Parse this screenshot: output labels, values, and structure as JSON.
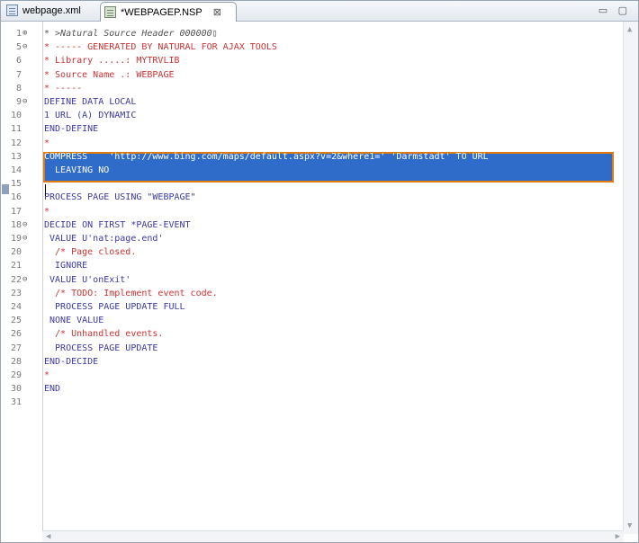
{
  "tabs": [
    {
      "label": "webpage.xml"
    },
    {
      "label": "*WEBPAGEP.NSP",
      "close": "⊠"
    }
  ],
  "window_controls": "▭ ▢",
  "lines": [
    {
      "num": "1",
      "fold": "⊕",
      "text": "* >Natural Source Header 000000▯",
      "style": "gray"
    },
    {
      "num": "5",
      "fold": "⊖",
      "text": "* ----- GENERATED BY NATURAL FOR AJAX TOOLS",
      "style": "red"
    },
    {
      "num": "6",
      "fold": "",
      "text": "* Library .....: MYTRVLIB",
      "style": "red"
    },
    {
      "num": "7",
      "fold": "",
      "text": "* Source Name .: WEBPAGE",
      "style": "red"
    },
    {
      "num": "8",
      "fold": "",
      "text": "* -----",
      "style": "red"
    },
    {
      "num": "9",
      "fold": "⊖",
      "text": "DEFINE DATA LOCAL",
      "style": "blue"
    },
    {
      "num": "10",
      "fold": "",
      "text": "1 URL (A) DYNAMIC",
      "style": "blue"
    },
    {
      "num": "11",
      "fold": "",
      "text": "END-DEFINE",
      "style": "blue"
    },
    {
      "num": "12",
      "fold": "",
      "text": "*",
      "style": "red"
    },
    {
      "num": "13",
      "fold": "",
      "text": "COMPRESS    'http://www.bing.com/maps/default.aspx?v=2&where1=' 'Darmstadt' TO URL",
      "style": "hl"
    },
    {
      "num": "14",
      "fold": "",
      "text": "  LEAVING NO",
      "style": "hl"
    },
    {
      "num": "15",
      "fold": "",
      "text": "",
      "style": "blue"
    },
    {
      "num": "16",
      "fold": "",
      "text": "PROCESS PAGE USING \"WEBPAGE\"",
      "style": "blue"
    },
    {
      "num": "17",
      "fold": "",
      "text": "*",
      "style": "red"
    },
    {
      "num": "18",
      "fold": "⊖",
      "text": "DECIDE ON FIRST *PAGE-EVENT",
      "style": "blue"
    },
    {
      "num": "19",
      "fold": "⊖",
      "text": " VALUE U'nat:page.end'",
      "style": "blue"
    },
    {
      "num": "20",
      "fold": "",
      "text": "  /* Page closed.",
      "style": "red"
    },
    {
      "num": "21",
      "fold": "",
      "text": "  IGNORE",
      "style": "blue"
    },
    {
      "num": "22",
      "fold": "⊖",
      "text": " VALUE U'onExit'",
      "style": "blue"
    },
    {
      "num": "23",
      "fold": "",
      "text": "  /* TODO: Implement event code.",
      "style": "red"
    },
    {
      "num": "24",
      "fold": "",
      "text": "  PROCESS PAGE UPDATE FULL",
      "style": "blue"
    },
    {
      "num": "25",
      "fold": "",
      "text": " NONE VALUE",
      "style": "blue"
    },
    {
      "num": "26",
      "fold": "",
      "text": "  /* Unhandled events.",
      "style": "red"
    },
    {
      "num": "27",
      "fold": "",
      "text": "  PROCESS PAGE UPDATE",
      "style": "blue"
    },
    {
      "num": "28",
      "fold": "",
      "text": "END-DECIDE",
      "style": "blue"
    },
    {
      "num": "29",
      "fold": "",
      "text": "*",
      "style": "red"
    },
    {
      "num": "30",
      "fold": "",
      "text": "END",
      "style": "blue"
    },
    {
      "num": "31",
      "fold": "",
      "text": "",
      "style": "blue"
    }
  ],
  "colors": {
    "keyword": "#3a3aa8",
    "comment": "#cc3333",
    "selection": "#2f6bc9",
    "selection_outline": "#e07b10"
  }
}
